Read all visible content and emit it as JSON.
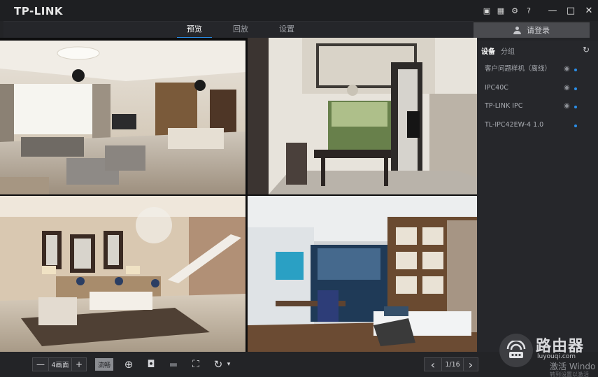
{
  "app": {
    "logo": "TP-LINK"
  },
  "titlebar": {
    "icons": [
      "screenshot-icon",
      "chip-icon",
      "gear-icon",
      "help-icon"
    ],
    "glyphs": {
      "screenshot": "▣",
      "chip": "▦",
      "gear": "⚙",
      "help": "?"
    },
    "min": "—",
    "max": "□",
    "close": "✕"
  },
  "nav": {
    "tabs": [
      {
        "label": "预览",
        "active": true
      },
      {
        "label": "回放",
        "active": false
      },
      {
        "label": "设置",
        "active": false
      }
    ]
  },
  "login": {
    "label": "请登录"
  },
  "side": {
    "tabs": [
      {
        "label": "设备",
        "active": true
      },
      {
        "label": "分组",
        "active": false
      }
    ],
    "refresh_glyph": "↻",
    "devices": [
      {
        "name": "客户问题样机（离线）",
        "eye": true,
        "online": true
      },
      {
        "name": "IPC40C",
        "eye": true,
        "online": true
      },
      {
        "name": "TP-LINK IPC",
        "eye": true,
        "online": true
      },
      {
        "name": "TL-IPC42EW-4 1.0",
        "eye": false,
        "online": true
      }
    ],
    "eye_glyph": "◉"
  },
  "toolbar": {
    "minus": "—",
    "layout": "4画面",
    "plus": "+",
    "stream": "流畅",
    "zoom_glyph": "⊕",
    "snapshot_glyph": "◘",
    "record_glyph": "▬",
    "fullscreen_glyph": "⛶",
    "cycle_glyph": "↻",
    "cycle_caret": "▾",
    "prev": "‹",
    "page": "1/16",
    "next": "›"
  },
  "watermark": {
    "title": "路由器",
    "url": "luyouqi.com",
    "activate": "激活 Windo",
    "activate_sub": "转到设置以激活"
  },
  "colors": {
    "accent": "#2a8ee8",
    "bg": "#232427"
  }
}
